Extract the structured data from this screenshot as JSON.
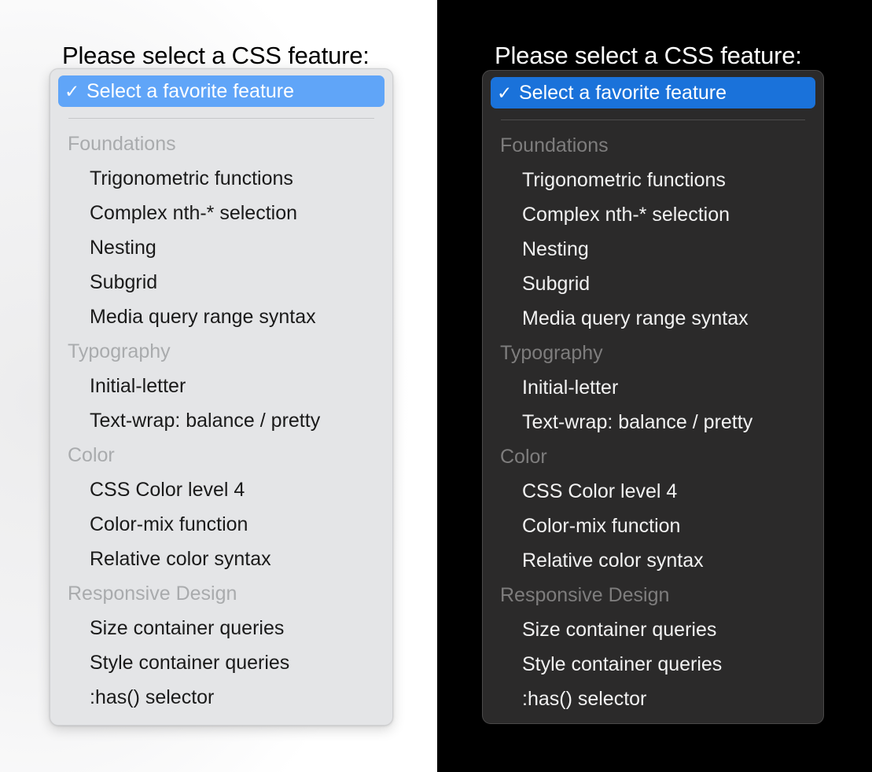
{
  "panels": [
    {
      "theme": "light",
      "heading": "Please select a CSS feature:",
      "selected_option": "Select a favorite feature",
      "check_icon": "✓",
      "icon_name": "checkmark-icon",
      "colors": {
        "backdrop": "#ffffff",
        "panel_background": "#e4e5e7",
        "panel_border": "#cfd0d2",
        "highlight": "#60a5f8",
        "highlight_text": "#ffffff",
        "group_label_text": "#a9abad",
        "option_text": "#1a1a1a",
        "separator": "#c6c7c9",
        "heading_text": "#000000"
      }
    },
    {
      "theme": "dark",
      "heading": "Please select a CSS feature:",
      "selected_option": "Select a favorite feature",
      "check_icon": "✓",
      "icon_name": "checkmark-icon",
      "colors": {
        "backdrop": "#000000",
        "panel_background": "#2b2a2a",
        "panel_border": "#4a4949",
        "highlight": "#1a72da",
        "highlight_text": "#ffffff",
        "group_label_text": "#7e7d7d",
        "option_text": "#f2f2f2",
        "separator": "#4d4c4c",
        "heading_text": "#ffffff"
      }
    }
  ],
  "groups": [
    {
      "label": "Foundations",
      "options": [
        "Trigonometric functions",
        "Complex nth-* selection",
        "Nesting",
        "Subgrid",
        "Media query range syntax"
      ]
    },
    {
      "label": "Typography",
      "options": [
        "Initial-letter",
        "Text-wrap: balance / pretty"
      ]
    },
    {
      "label": "Color",
      "options": [
        "CSS Color level 4",
        "Color-mix function",
        "Relative color syntax"
      ]
    },
    {
      "label": "Responsive Design",
      "options": [
        "Size container queries",
        "Style container queries",
        ":has() selector"
      ]
    }
  ]
}
